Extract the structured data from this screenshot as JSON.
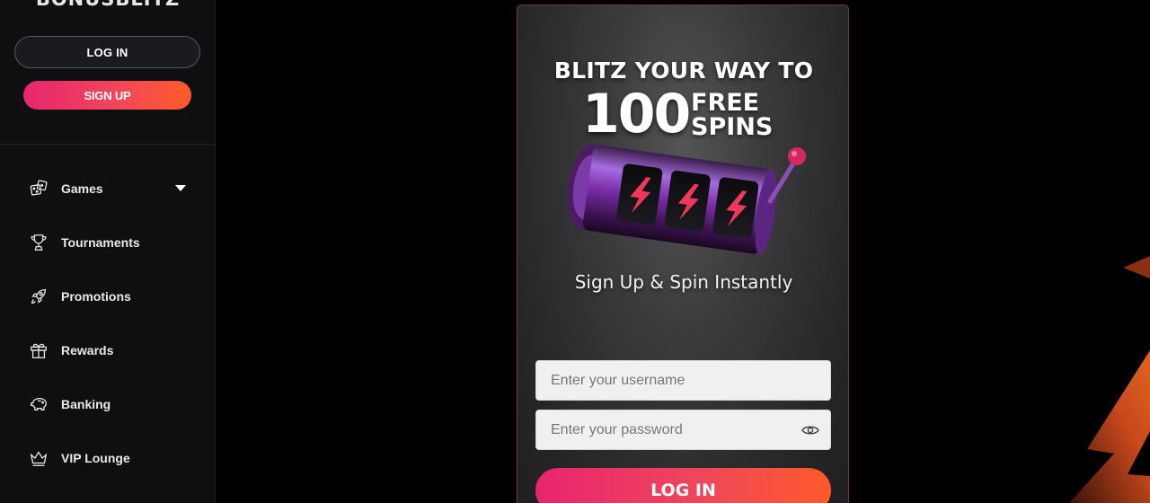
{
  "brand": {
    "logo_text": "BONUSBLITZ"
  },
  "sidebar": {
    "login_label": "LOG IN",
    "signup_label": "SIGN UP",
    "items": [
      {
        "label": "Games",
        "icon": "dice-icon",
        "has_dropdown": true
      },
      {
        "label": "Tournaments",
        "icon": "trophy-icon"
      },
      {
        "label": "Promotions",
        "icon": "rocket-icon"
      },
      {
        "label": "Rewards",
        "icon": "gift-icon"
      },
      {
        "label": "Banking",
        "icon": "piggy-bank-icon"
      },
      {
        "label": "VIP Lounge",
        "icon": "crown-icon"
      }
    ]
  },
  "promo": {
    "line1": "BLITZ YOUR WAY TO",
    "amount": "100",
    "free": "FREE",
    "spins": "SPINS",
    "subtitle": "Sign Up & Spin Instantly"
  },
  "form": {
    "username_placeholder": "Enter your username",
    "password_placeholder": "Enter your password",
    "login_label": "LOG IN"
  },
  "colors": {
    "accent_start": "#e8256f",
    "accent_end": "#ff5a2c",
    "background": "#000000",
    "sidebar_bg": "#0f0f12"
  }
}
